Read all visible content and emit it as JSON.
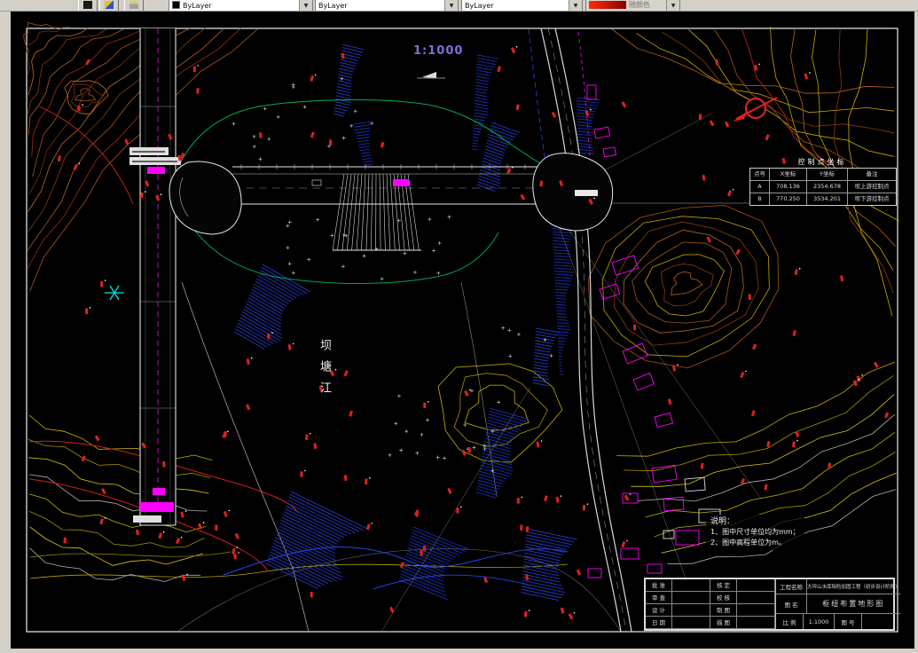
{
  "toolbar": {
    "color_value": "ByLayer",
    "linetype_value": "ByLayer",
    "lineweight_value": "ByLayer",
    "plotstyle_value": "随颜色"
  },
  "drawing": {
    "scale_label": "1:1000",
    "river_name": "坝塘江",
    "control_table": {
      "title": "控制点坐标",
      "headers": [
        "点号",
        "X坐标",
        "Y坐标",
        "备注"
      ],
      "rows": [
        [
          "A",
          "708.136",
          "2354.678",
          "坝上游控制点"
        ],
        [
          "B",
          "770.250",
          "3534.201",
          "坝下游控制点"
        ]
      ]
    },
    "notes": {
      "title": "说明：",
      "items": [
        "1、图中尺寸单位均为mm；",
        "2、图中高程单位为m。"
      ]
    },
    "title_block": {
      "left_rows": [
        [
          "批 准",
          "",
          "核 定",
          ""
        ],
        [
          "审 查",
          "",
          "校 核",
          ""
        ],
        [
          "设 计",
          "",
          "制 图",
          ""
        ],
        [
          "日 期",
          "",
          "描 图",
          ""
        ]
      ],
      "project_label": "工程名称",
      "project_name": "大坪山水库除险加固工程（初步设计阶段）",
      "name_label": "图 名",
      "drawing_name": "枢纽布置地形图",
      "scale_label": "比 例",
      "scale_value": "1:1000",
      "no_label": "图 号",
      "no_value": ""
    }
  }
}
